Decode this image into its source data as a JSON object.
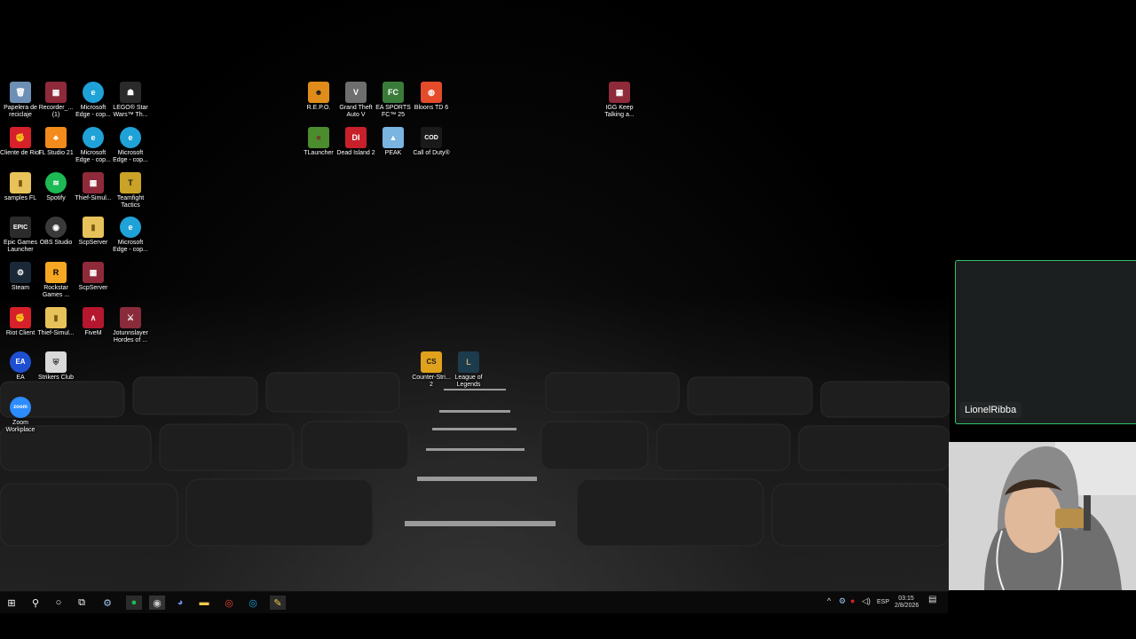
{
  "desktop_icons": [
    {
      "label": "Papelera de reciclaje",
      "color": "#6d8fb5",
      "glyph": "🗑"
    },
    {
      "label": "Recorder_... (1)",
      "color": "#8e2a3a",
      "glyph": "▦"
    },
    {
      "label": "Microsoft Edge - cop...",
      "color": "#1fa2d8",
      "glyph": "e"
    },
    {
      "label": "LEGO® Star Wars™ Th...",
      "color": "#2a2a2a",
      "glyph": "☗"
    },
    {
      "label": "Cliente de Riot",
      "color": "#d6202a",
      "glyph": "✊"
    },
    {
      "label": "FL Studio 21",
      "color": "#f28a1c",
      "glyph": "♣"
    },
    {
      "label": "Microsoft Edge - cop...",
      "color": "#1fa2d8",
      "glyph": "e"
    },
    {
      "label": "Microsoft Edge - cop...",
      "color": "#1fa2d8",
      "glyph": "e"
    },
    {
      "label": "samples FL",
      "color": "#e7c25a",
      "glyph": "▮"
    },
    {
      "label": "Spotify",
      "color": "#1db954",
      "glyph": "≋"
    },
    {
      "label": "Thief-Simul...",
      "color": "#8e2a3a",
      "glyph": "▦"
    },
    {
      "label": "Teamfight Tactics",
      "color": "#c9a227",
      "glyph": "T"
    },
    {
      "label": "Epic Games Launcher",
      "color": "#2b2b2b",
      "glyph": "EPIC"
    },
    {
      "label": "OBS Studio",
      "color": "#3a3a3a",
      "glyph": "◉"
    },
    {
      "label": "ScpServer",
      "color": "#e7c25a",
      "glyph": "▮"
    },
    {
      "label": "Microsoft Edge - cop...",
      "color": "#1fa2d8",
      "glyph": "e"
    },
    {
      "label": "Steam",
      "color": "#1b2838",
      "glyph": "⚙"
    },
    {
      "label": "Rockstar Games ...",
      "color": "#f5a623",
      "glyph": "R"
    },
    {
      "label": "ScpServer",
      "color": "#8e2a3a",
      "glyph": "▦"
    },
    {
      "label": "Riot Client",
      "color": "#d6202a",
      "glyph": "✊"
    },
    {
      "label": "Thief-Simul...",
      "color": "#e7c25a",
      "glyph": "▮"
    },
    {
      "label": "FiveM",
      "color": "#b5172e",
      "glyph": "∧"
    },
    {
      "label": "Jotunnslayer Hordes of ...",
      "color": "#8a2b3b",
      "glyph": "⚔"
    },
    {
      "label": "EA",
      "color": "#1f4fd1",
      "glyph": "EA"
    },
    {
      "label": "Strikers Club",
      "color": "#d9d9d9",
      "glyph": "⛨"
    },
    {
      "label": "Zoom Workplace",
      "color": "#2d8cff",
      "glyph": "zoom"
    },
    {
      "label": "R.E.P.O.",
      "color": "#e08c1a",
      "glyph": "☻"
    },
    {
      "label": "Grand Theft Auto V",
      "color": "#6e6e6e",
      "glyph": "V"
    },
    {
      "label": "EA SPORTS FC™ 25",
      "color": "#3a7b3a",
      "glyph": "FC"
    },
    {
      "label": "Bloons TD 6",
      "color": "#e34b2a",
      "glyph": "◍"
    },
    {
      "label": "IGG Keep Talking a...",
      "color": "#8e2a3a",
      "glyph": "▦"
    },
    {
      "label": "TLauncher",
      "color": "#4b8c2e",
      "glyph": "■"
    },
    {
      "label": "Dead Island 2",
      "color": "#c8202a",
      "glyph": "DI"
    },
    {
      "label": "PEAK",
      "color": "#7ab4e0",
      "glyph": "▲"
    },
    {
      "label": "Call of Duty®",
      "color": "#1a1a1a",
      "glyph": "COD"
    },
    {
      "label": "Counter-Stri... 2",
      "color": "#e0a21c",
      "glyph": "CS"
    },
    {
      "label": "League of Legends",
      "color": "#1c3b4d",
      "glyph": "L"
    }
  ],
  "taskbar": {
    "start": "⊞",
    "search": "⚲",
    "cortana": "○",
    "task_view": "⧉",
    "pinned": [
      {
        "name": "steam-taskbar-icon",
        "glyph": "⚙",
        "color": "#9ec6ea"
      },
      {
        "name": "spotify-taskbar-icon",
        "glyph": "●",
        "color": "#1db954"
      },
      {
        "name": "obs-taskbar-icon",
        "glyph": "◉",
        "color": "#cccccc"
      },
      {
        "name": "discord-taskbar-icon",
        "glyph": "◕",
        "color": "#7289da"
      },
      {
        "name": "file-explorer-taskbar-icon",
        "glyph": "▬",
        "color": "#f2c94c"
      },
      {
        "name": "chrome-taskbar-icon",
        "glyph": "◎",
        "color": "#ea4335"
      },
      {
        "name": "edge-taskbar-icon",
        "glyph": "◎",
        "color": "#1fa2d8"
      },
      {
        "name": "sticky-taskbar-icon",
        "glyph": "✎",
        "color": "#f2c94c"
      }
    ],
    "tray": {
      "language": "ESP",
      "time": "03:15",
      "date": "2/8/2026"
    }
  },
  "zoom_panel": {
    "participant_name": "LionelRibba"
  }
}
